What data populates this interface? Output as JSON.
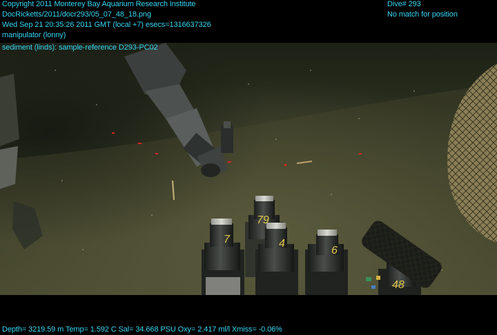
{
  "overlay": {
    "copyright": "Copyright 2011 Monterey Bay Aquarium Research Institute",
    "file_path": "DocRicketts/2011/docr293/05_07_48_18.png",
    "timestamp": "Wed Sep 21 20:35:26 2011 GMT (local +7)  esecs=1316637326",
    "activity": "manipulator (lonny)",
    "annotation": "sediment (linds): sample-reference D293-PC02",
    "dive": "Dive# 293",
    "position_status": "No match for position",
    "telemetry": "Depth= 3219.59 m  Temp= 1.592 C  Sal= 34.668 PSU  Oxy= 2.417 ml/l  Xmiss= -0.06%"
  },
  "scene": {
    "tube_labels": [
      "79",
      "7",
      "4",
      "6",
      "48"
    ],
    "colors": {
      "hud_text": "#35d6f2",
      "seafloor": "#3d4028",
      "laser": "#e02020"
    }
  }
}
